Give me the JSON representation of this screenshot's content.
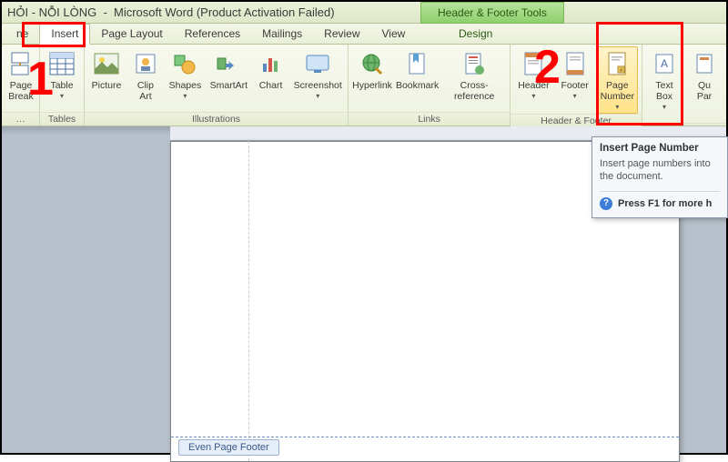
{
  "title_bar": {
    "doc_fragment": "HỎI  -  NỖI LÒNG",
    "app": "Microsoft Word",
    "activation": "(Product Activation Failed)",
    "contextual_title": "Header & Footer Tools"
  },
  "tabs": {
    "home_tail": "ne",
    "insert": "Insert",
    "page_layout": "Page Layout",
    "references": "References",
    "mailings": "Mailings",
    "review": "Review",
    "view": "View",
    "design": "Design"
  },
  "ribbon": {
    "pages": {
      "page_break": "Page\nBreak",
      "group": "…"
    },
    "tables": {
      "table": "Table",
      "group": "Tables"
    },
    "illustrations": {
      "picture": "Picture",
      "clip_art": "Clip\nArt",
      "shapes": "Shapes",
      "smartart": "SmartArt",
      "chart": "Chart",
      "screenshot": "Screenshot",
      "group": "Illustrations"
    },
    "links": {
      "hyperlink": "Hyperlink",
      "bookmark": "Bookmark",
      "cross_reference": "Cross-reference",
      "group": "Links"
    },
    "header_footer": {
      "header": "Header",
      "footer": "Footer",
      "page_number": "Page\nNumber",
      "group": "Header & Footer"
    },
    "text": {
      "text_box": "Text\nBox",
      "quick_parts": "Qu\nPar",
      "group": ""
    }
  },
  "doc": {
    "footer_tab": "Even Page Footer"
  },
  "tooltip": {
    "title": "Insert Page Number",
    "body": "Insert page numbers into the document.",
    "help": "Press F1 for more h"
  },
  "annotations": {
    "one": "1",
    "two": "2"
  },
  "colors": {
    "highlight_border": "#ff0000",
    "ribbon_accent": "#8fcf6f"
  }
}
